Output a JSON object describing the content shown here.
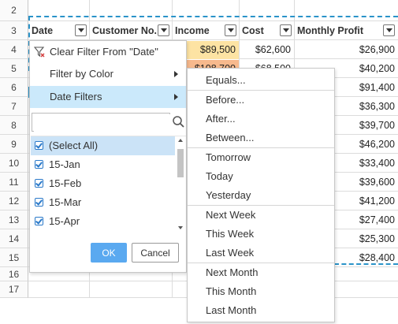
{
  "row_numbers": [
    "2",
    "3",
    "4",
    "5",
    "6",
    "7",
    "8",
    "9",
    "10",
    "11",
    "12",
    "13",
    "14",
    "15",
    "16",
    "17"
  ],
  "headers": {
    "date": "Date",
    "customer": "Customer No.",
    "income": "Income",
    "cost": "Cost",
    "profit": "Monthly Profit"
  },
  "visible_cells": {
    "income_r4": "$89,500",
    "cost_r4": "$62,600",
    "income_r5": "$108,700",
    "cost_r5": "$68,500"
  },
  "monthly_profit": [
    "$26,900",
    "$40,200",
    "$91,400",
    "$36,300",
    "$39,700",
    "$46,200",
    "$33,400",
    "$39,600",
    "$41,200",
    "$27,400",
    "$25,300",
    "$28,400"
  ],
  "filter_panel": {
    "clear_filter": "Clear Filter From \"Date\"",
    "filter_by_color": "Filter by Color",
    "date_filters": "Date Filters",
    "search_value": "",
    "list_items": [
      "(Select All)",
      "15-Jan",
      "15-Feb",
      "15-Mar",
      "15-Apr"
    ],
    "ok": "OK",
    "cancel": "Cancel"
  },
  "date_filter_submenu": [
    [
      "Equals..."
    ],
    [
      "Before...",
      "After...",
      "Between..."
    ],
    [
      "Tomorrow",
      "Today",
      "Yesterday"
    ],
    [
      "Next Week",
      "This Week",
      "Last Week"
    ],
    [
      "Next Month",
      "This Month",
      "Last Month"
    ]
  ],
  "colors": {
    "accent": "#2a93c9",
    "selection": "#cbe9fb",
    "ok_button": "#5aa9f0",
    "income_highlight": "#fde3a3"
  }
}
